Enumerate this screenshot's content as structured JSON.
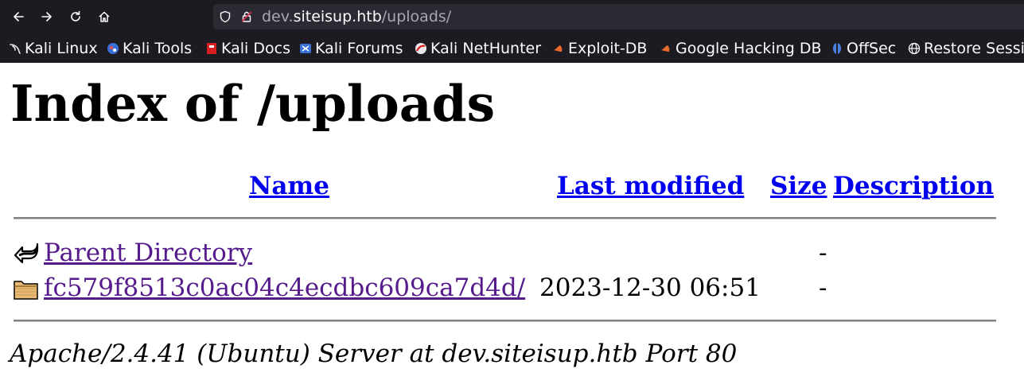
{
  "browser": {
    "url_host_prefix": "dev.",
    "url_host_domain": "siteisup.htb",
    "url_path": "/uploads/",
    "bookmarks": [
      {
        "label": "Kali Linux",
        "icon": "kali-dragon-icon"
      },
      {
        "label": "Kali Tools",
        "icon": "kali-tools-icon"
      },
      {
        "label": "Kali Docs",
        "icon": "kali-docs-icon"
      },
      {
        "label": "Kali Forums",
        "icon": "kali-forums-icon"
      },
      {
        "label": "Kali NetHunter",
        "icon": "kali-nethunter-icon"
      },
      {
        "label": "Exploit-DB",
        "icon": "exploit-db-icon"
      },
      {
        "label": "Google Hacking DB",
        "icon": "ghdb-icon"
      },
      {
        "label": "OffSec",
        "icon": "offsec-icon"
      },
      {
        "label": "Restore Sessi",
        "icon": "globe-icon"
      }
    ]
  },
  "page": {
    "title": "Index of /uploads",
    "columns": {
      "name": "Name",
      "last_modified": "Last modified",
      "size": "Size",
      "description": "Description"
    },
    "rows": [
      {
        "name": "Parent Directory",
        "last_modified": "",
        "size": "-",
        "icon": "back-arrow-icon"
      },
      {
        "name": "fc579f8513c0ac04c4ecdbc609ca7d4d/",
        "last_modified": "2023-12-30 06:51",
        "size": "-",
        "icon": "folder-icon"
      }
    ],
    "address": "Apache/2.4.41 (Ubuntu) Server at dev.siteisup.htb Port 80"
  },
  "colors": {
    "chrome_bg": "#1c1b22",
    "urlbar_bg": "#2b2a33",
    "link": "#0000ee",
    "visited_link": "#551a8b"
  }
}
